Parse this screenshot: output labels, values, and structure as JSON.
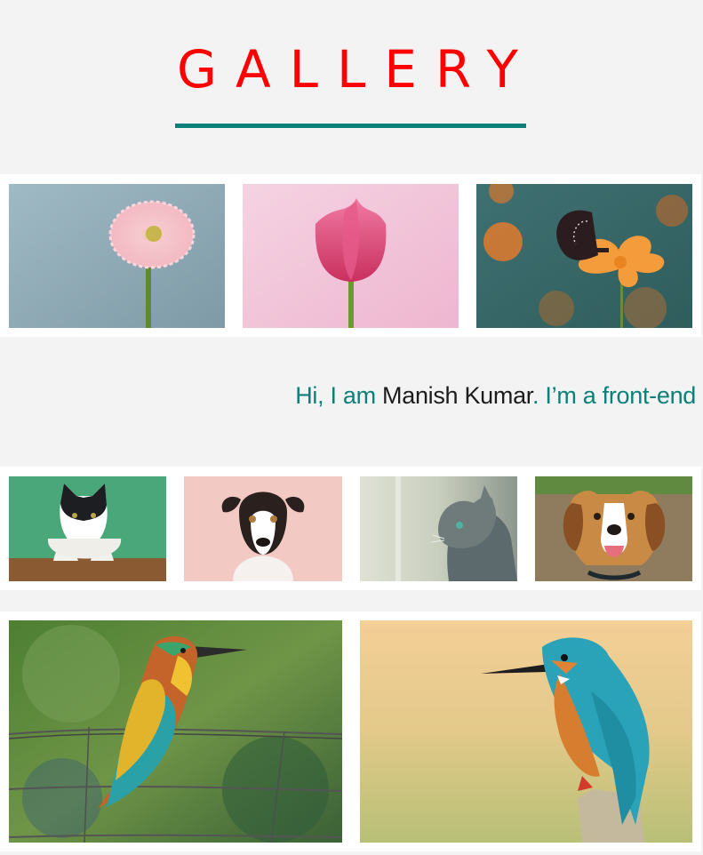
{
  "page": {
    "title": "GALLERY",
    "colors": {
      "title": "#ff0000",
      "accent": "#0b8079",
      "background": "#f3f3f3"
    }
  },
  "intro": {
    "greeting": "Hi, I am ",
    "name": "Manish Kumar",
    "rest": ". I’m a front-end"
  },
  "gallery": {
    "row1": [
      "pink-gerbera-daisy",
      "pink-tulip",
      "butterfly-on-orange-cosmos"
    ],
    "row2": [
      "black-white-cat",
      "jack-russell-dog",
      "tabby-cat",
      "beagle-dog"
    ],
    "row3": [
      "bee-eater-bird",
      "kingfisher-bird"
    ]
  }
}
